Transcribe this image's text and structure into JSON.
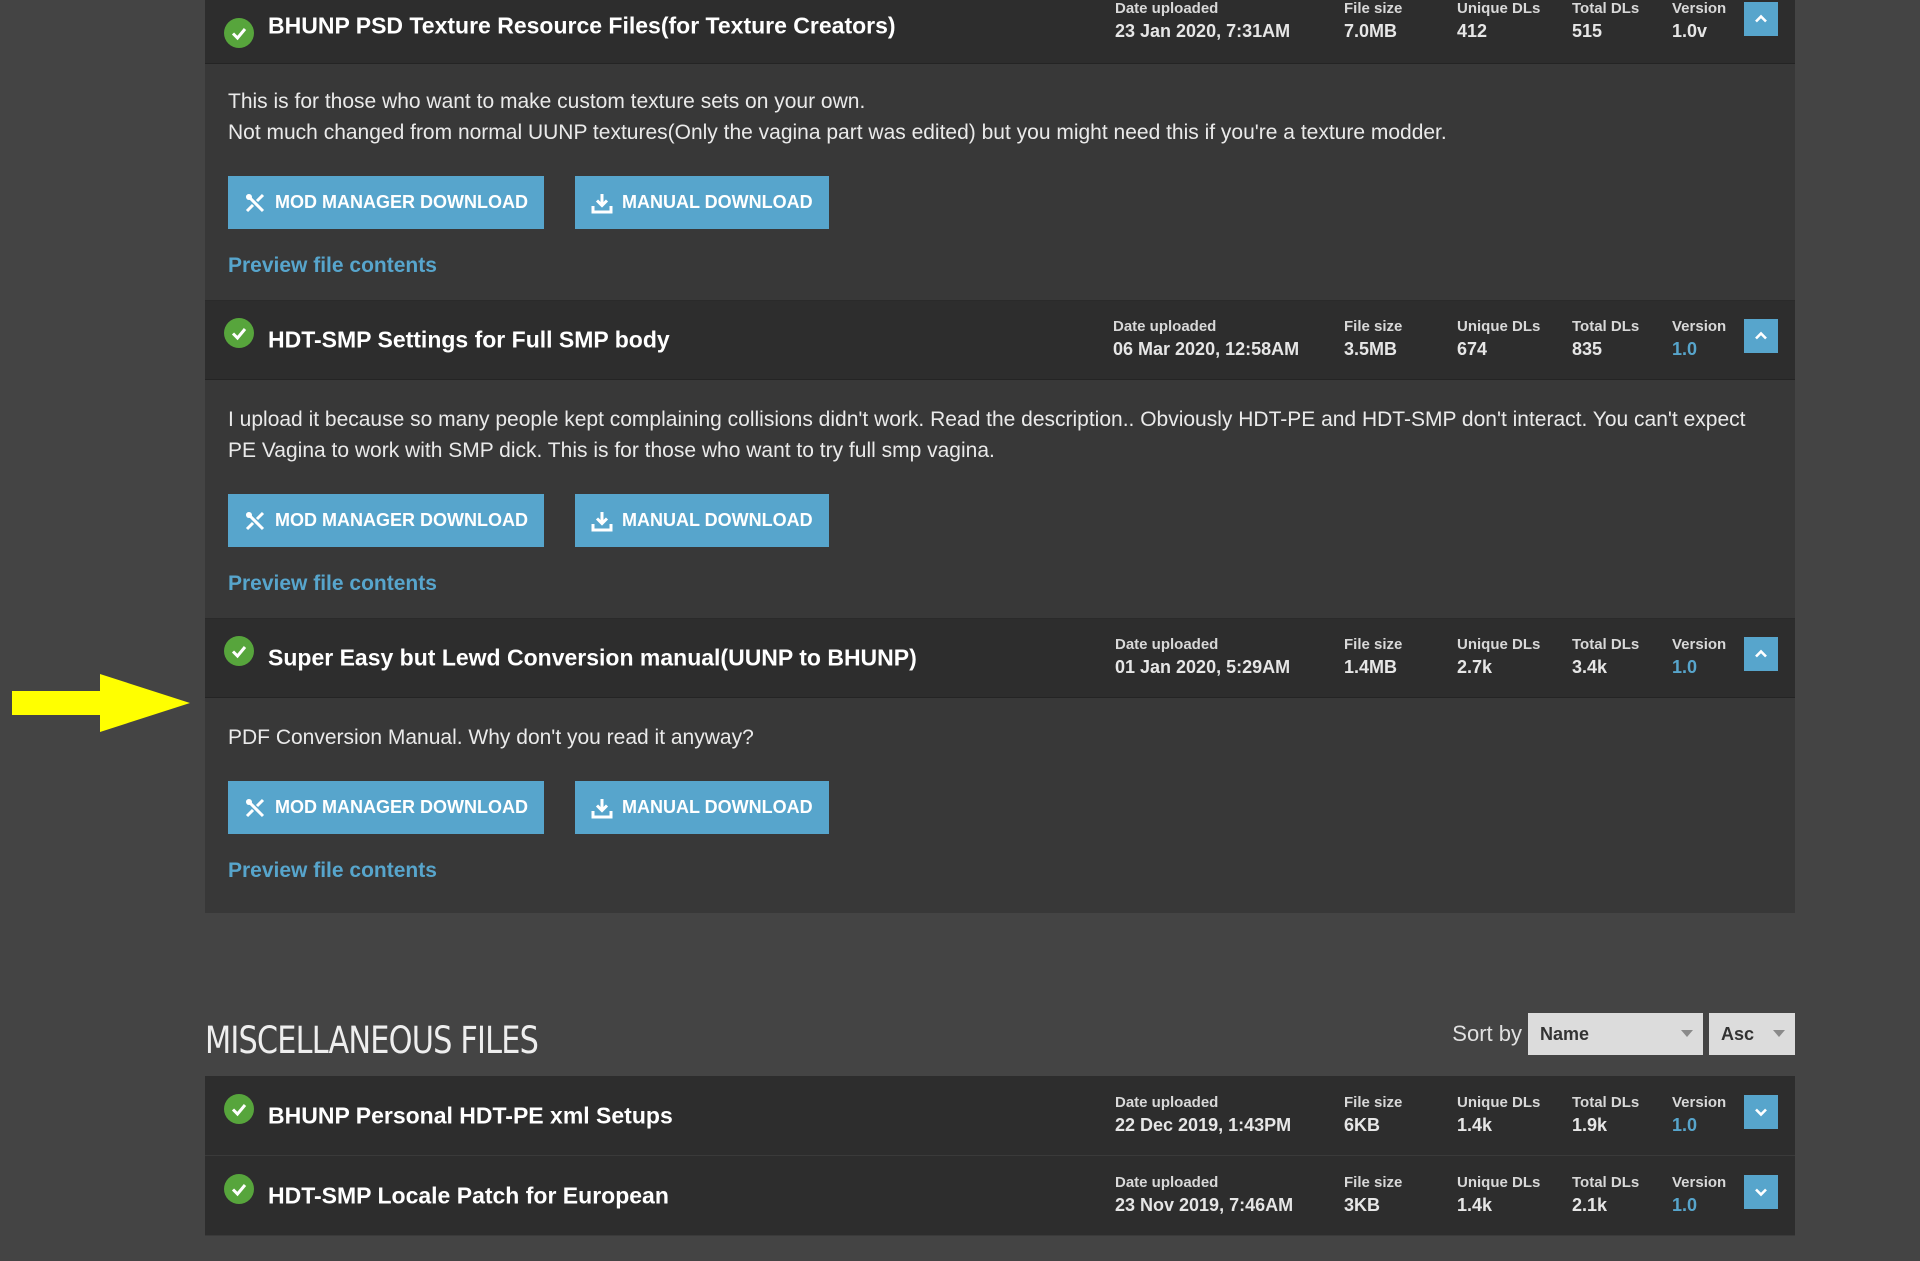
{
  "colors": {
    "accent": "#57a5cc",
    "check": "#57a53c",
    "arrow": "#ffff00"
  },
  "main_files": [
    {
      "title": "BHUNP PSD Texture Resource Files(for Texture Creators)",
      "date_label": "Date uploaded",
      "date": "23 Jan 2020, 7:31AM",
      "size_label": "File size",
      "size": "7.0MB",
      "unique_label": "Unique DLs",
      "unique": "412",
      "total_label": "Total DLs",
      "total": "515",
      "version_label": "Version",
      "version": "1.0v",
      "desc_lines": [
        "This is for those who want to make custom texture sets on your own.",
        "Not much changed from normal UUNP textures(Only the vagina part was edited) but you might need this if you're a texture modder."
      ],
      "mod_manager_label": "MOD MANAGER DOWNLOAD",
      "manual_label": "MANUAL DOWNLOAD",
      "preview_label": "Preview file contents"
    },
    {
      "title": "HDT-SMP Settings for Full SMP body",
      "date_label": "Date uploaded",
      "date": "06 Mar 2020, 12:58AM",
      "size_label": "File size",
      "size": "3.5MB",
      "unique_label": "Unique DLs",
      "unique": "674",
      "total_label": "Total DLs",
      "total": "835",
      "version_label": "Version",
      "version": "1.0",
      "desc_lines": [
        "I upload it because so many people kept complaining collisions didn't work. Read the description.. Obviously HDT-PE and HDT-SMP don't interact. You can't expect PE Vagina to work with SMP dick. This is for those who want to try full smp vagina."
      ],
      "mod_manager_label": "MOD MANAGER DOWNLOAD",
      "manual_label": "MANUAL DOWNLOAD",
      "preview_label": "Preview file contents"
    },
    {
      "title": "Super Easy but Lewd Conversion manual(UUNP to BHUNP)",
      "date_label": "Date uploaded",
      "date": "01 Jan 2020, 5:29AM",
      "size_label": "File size",
      "size": "1.4MB",
      "unique_label": "Unique DLs",
      "unique": "2.7k",
      "total_label": "Total DLs",
      "total": "3.4k",
      "version_label": "Version",
      "version": "1.0",
      "desc_lines": [
        "PDF Conversion Manual. Why don't you read it anyway?"
      ],
      "mod_manager_label": "MOD MANAGER DOWNLOAD",
      "manual_label": "MANUAL DOWNLOAD",
      "preview_label": "Preview file contents"
    }
  ],
  "misc": {
    "title": "MISCELLANEOUS FILES",
    "sort_label": "Sort by",
    "sort_field": "Name",
    "sort_order": "Asc",
    "files": [
      {
        "title": "BHUNP Personal HDT-PE xml Setups",
        "date_label": "Date uploaded",
        "date": "22 Dec 2019, 1:43PM",
        "size_label": "File size",
        "size": "6KB",
        "unique_label": "Unique DLs",
        "unique": "1.4k",
        "total_label": "Total DLs",
        "total": "1.9k",
        "version_label": "Version",
        "version": "1.0"
      },
      {
        "title": "HDT-SMP Locale Patch for European",
        "date_label": "Date uploaded",
        "date": "23 Nov 2019, 7:46AM",
        "size_label": "File size",
        "size": "3KB",
        "unique_label": "Unique DLs",
        "unique": "1.4k",
        "total_label": "Total DLs",
        "total": "2.1k",
        "version_label": "Version",
        "version": "1.0"
      }
    ]
  }
}
